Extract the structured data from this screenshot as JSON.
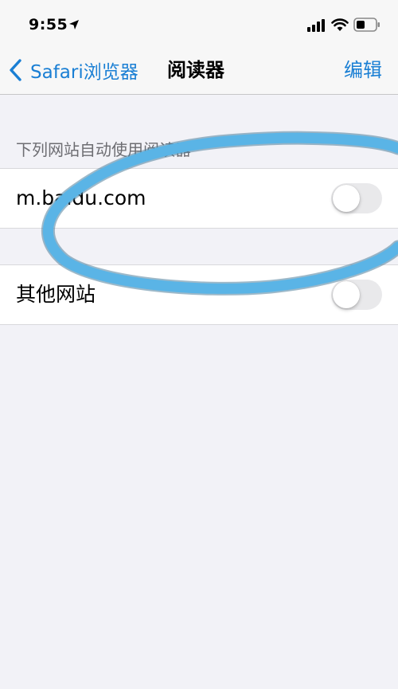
{
  "status_bar": {
    "time": "9:55",
    "location_icon": "location-arrow-icon",
    "signal_icon": "cellular-signal-icon",
    "wifi_icon": "wifi-icon",
    "battery_icon": "battery-icon"
  },
  "nav": {
    "back_label": "Safari浏览器",
    "title": "阅读器",
    "edit_label": "编辑",
    "accent_color": "#1a7fd4"
  },
  "section": {
    "header": "下列网站自动使用阅读器"
  },
  "sites": [
    {
      "label": "m.baidu.com",
      "toggle_on": false
    }
  ],
  "other_sites": {
    "label": "其他网站",
    "toggle_on": false
  },
  "annotation": {
    "stroke_color": "#5ab4e6",
    "shape": "hand-drawn-loop"
  }
}
